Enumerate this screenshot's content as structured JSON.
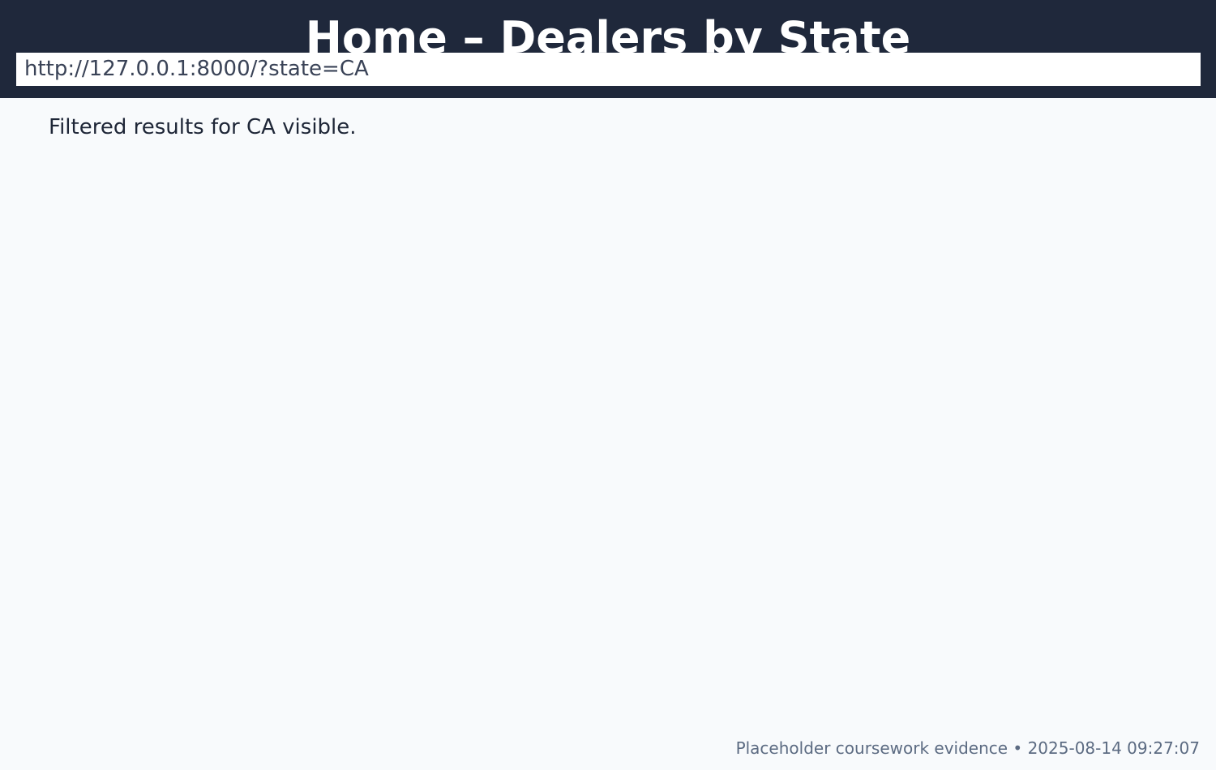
{
  "header": {
    "title": "Home – Dealers by State",
    "url": "http://127.0.0.1:8000/?state=CA"
  },
  "main": {
    "message": "Filtered results for CA visible."
  },
  "footer": {
    "caption": "Placeholder coursework evidence • 2025-08-14 09:27:07"
  },
  "colors": {
    "header_background": "#1f283b",
    "page_background": "#f8fafc",
    "title_text": "#ffffff",
    "body_text": "#1e2637",
    "footer_text": "#5c6b82"
  }
}
